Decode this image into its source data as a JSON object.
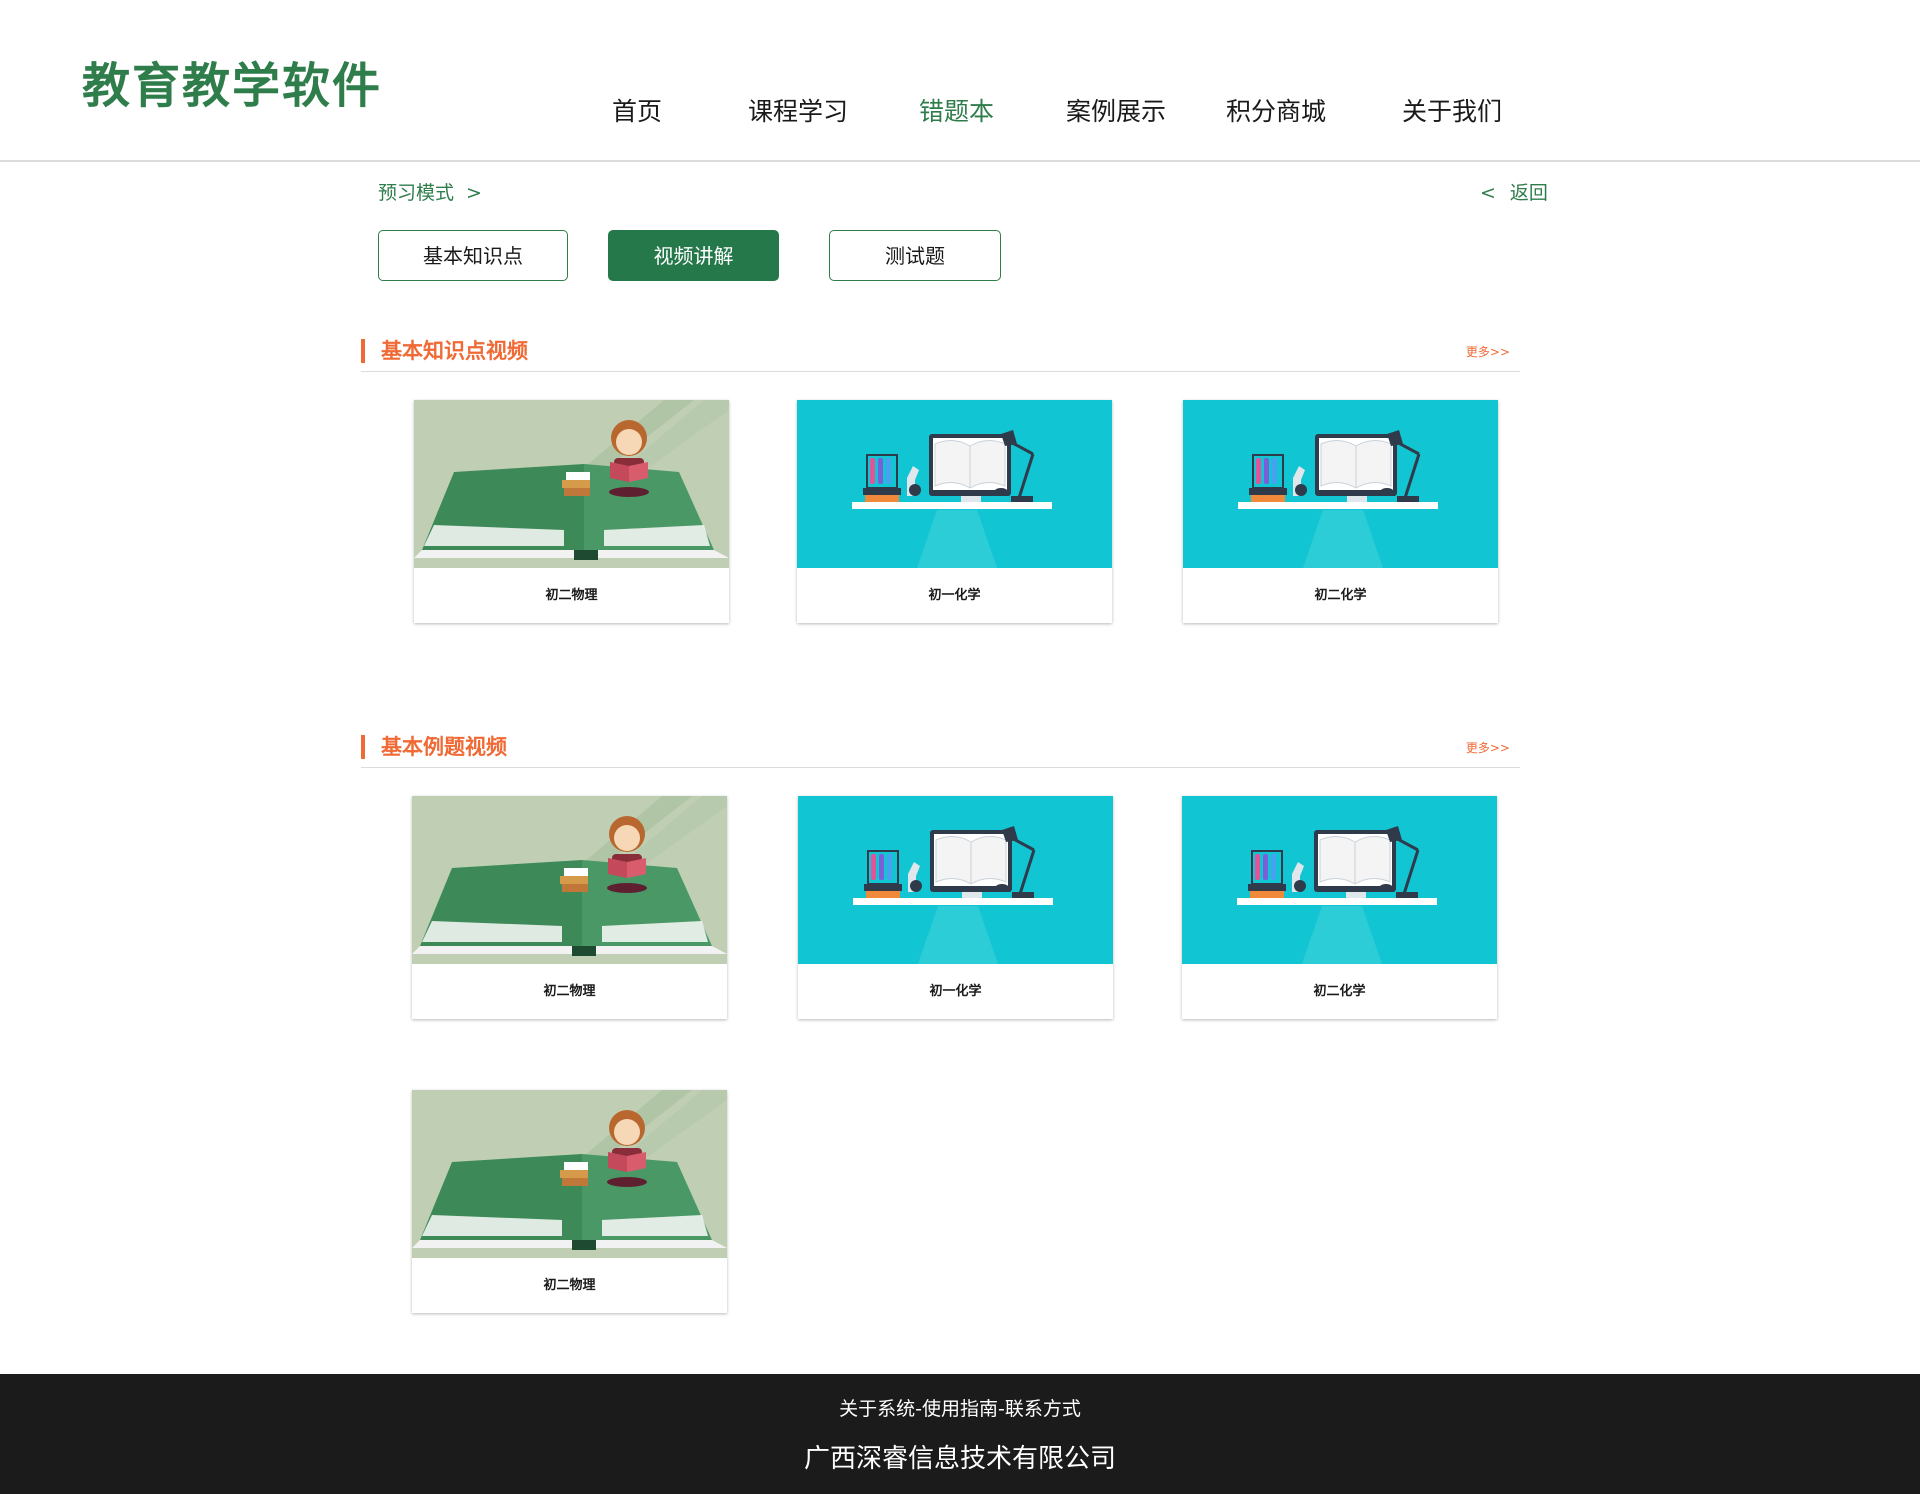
{
  "logo": {
    "text": "教育教学软件"
  },
  "nav": {
    "items": [
      {
        "label": "首页"
      },
      {
        "label": "课程学习"
      },
      {
        "label": "错题本",
        "active": true
      },
      {
        "label": "案例展示"
      },
      {
        "label": "积分商城"
      },
      {
        "label": "关于我们"
      }
    ]
  },
  "breadcrumb": {
    "label": "预习模式",
    "separator": ">"
  },
  "back": {
    "arrow": "<",
    "label": "返回"
  },
  "modes": [
    {
      "label": "基本知识点"
    },
    {
      "label": "视频讲解",
      "active": true
    },
    {
      "label": "测试题"
    }
  ],
  "sections": [
    {
      "title": "基本知识点视频",
      "more": "更多>>",
      "cards": [
        {
          "caption": "初二物理",
          "image": "girl-reading-book-illustration"
        },
        {
          "caption": "初一化学",
          "image": "lab-desk-open-book-illustration"
        },
        {
          "caption": "初二化学",
          "image": "lab-desk-open-book-illustration"
        }
      ]
    },
    {
      "title": "基本例题视频",
      "more": "更多>>",
      "cards": [
        {
          "caption": "初二物理",
          "image": "girl-reading-book-illustration"
        },
        {
          "caption": "初一化学",
          "image": "lab-desk-open-book-illustration"
        },
        {
          "caption": "初二化学",
          "image": "lab-desk-open-book-illustration"
        },
        {
          "caption": "初二物理",
          "image": "girl-reading-book-illustration"
        }
      ]
    }
  ],
  "footer": {
    "links": "关于系统-使用指南-联系方式",
    "company": "广西深睿信息技术有限公司"
  },
  "colors": {
    "brand_green": "#2e7d4b",
    "accent_orange": "#f06a35",
    "footer_bg": "#1b1b1b",
    "thumb_teal": "#11c6d2",
    "thumb_sage": "#c0cfb4"
  }
}
